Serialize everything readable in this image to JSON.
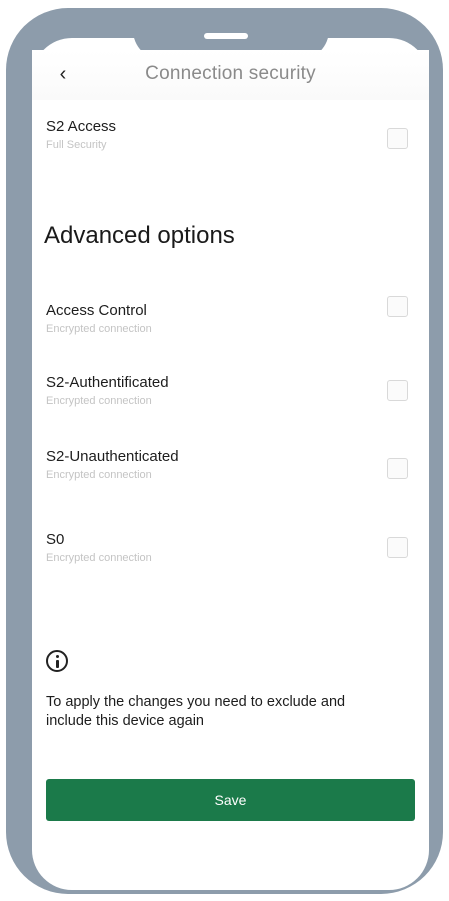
{
  "header": {
    "title": "Connection security"
  },
  "s2_access": {
    "title": "S2 Access",
    "subtitle": "Full Security"
  },
  "advanced": {
    "title": "Advanced options",
    "items": [
      {
        "title": "Access Control",
        "subtitle": "Encrypted connection"
      },
      {
        "title": "S2-Authentificated",
        "subtitle": "Encrypted connection"
      },
      {
        "title": "S2-Unauthenticated",
        "subtitle": "Encrypted connection"
      },
      {
        "title": "S0",
        "subtitle": "Encrypted connection"
      }
    ]
  },
  "info": {
    "text": "To apply the changes you need to exclude and include this device again"
  },
  "save": {
    "label": "Save"
  },
  "colors": {
    "frame": "#8d9cab",
    "primary_button": "#1b7a4a"
  }
}
